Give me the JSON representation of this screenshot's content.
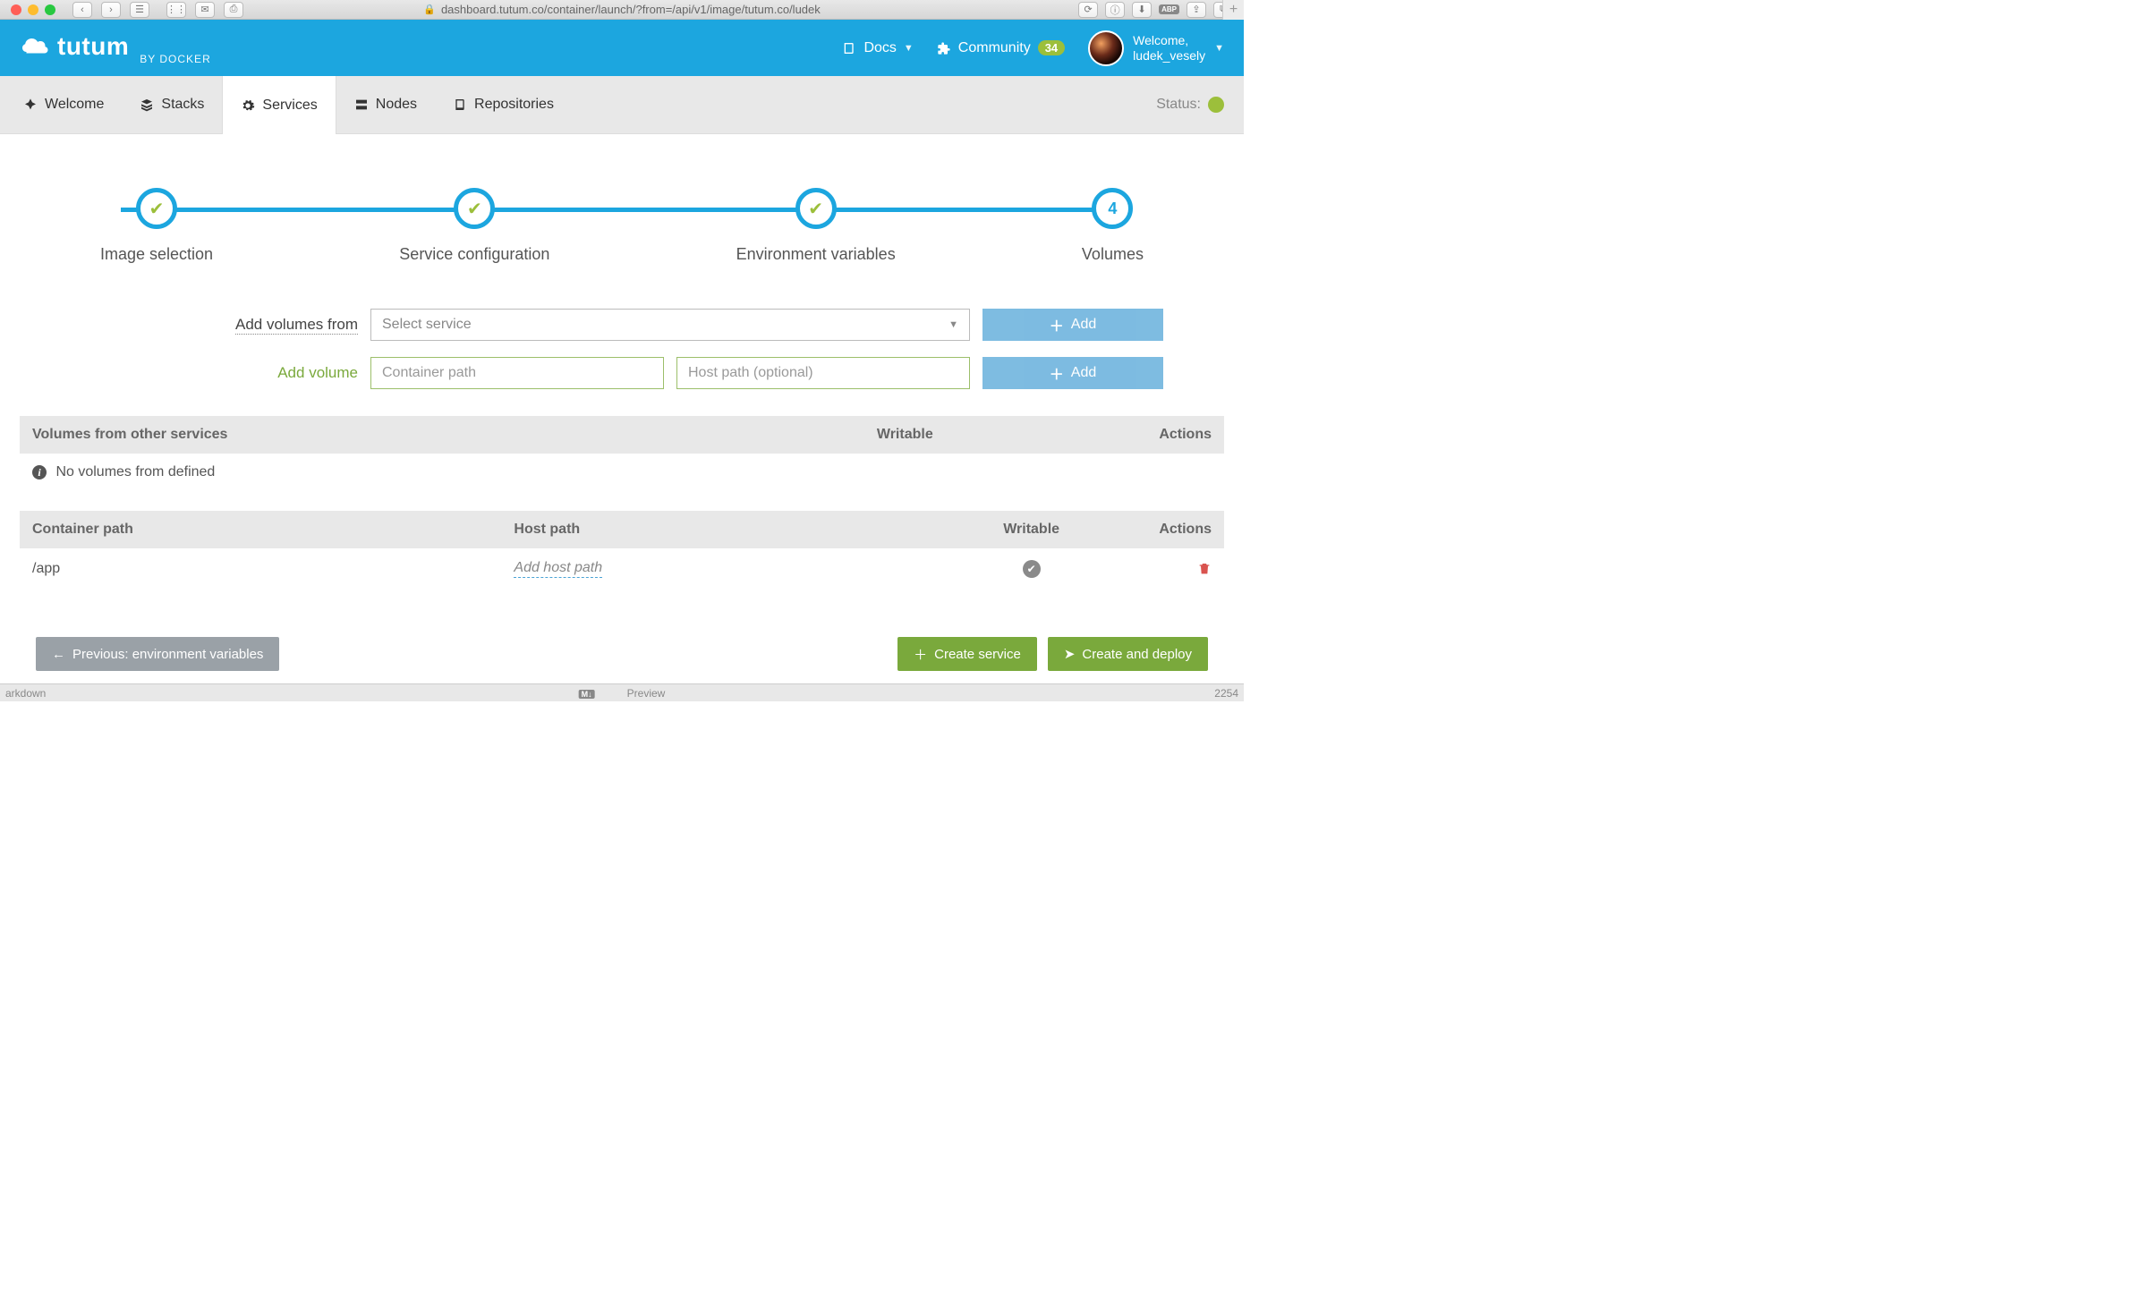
{
  "browser": {
    "url": "dashboard.tutum.co/container/launch/?from=/api/v1/image/tutum.co/ludek"
  },
  "brand": {
    "name": "tutum",
    "byline": "BY DOCKER"
  },
  "topnav": {
    "docs": "Docs",
    "community": "Community",
    "community_count": "34",
    "welcome": "Welcome,",
    "username": "ludek_vesely"
  },
  "tabs": {
    "welcome": "Welcome",
    "stacks": "Stacks",
    "services": "Services",
    "nodes": "Nodes",
    "repositories": "Repositories",
    "status_label": "Status:"
  },
  "stepper": {
    "s1": "Image selection",
    "s2": "Service configuration",
    "s3": "Environment variables",
    "s4": "Volumes",
    "s4_num": "4"
  },
  "form": {
    "add_volumes_from_label": "Add volumes from",
    "select_service_placeholder": "Select service",
    "add_button": "Add",
    "add_volume_label": "Add volume",
    "container_path_placeholder": "Container path",
    "host_path_placeholder": "Host path (optional)"
  },
  "table1": {
    "col1": "Volumes from other services",
    "col2": "Writable",
    "col3": "Actions",
    "empty": "No volumes from defined"
  },
  "table2": {
    "col1": "Container path",
    "col2": "Host path",
    "col3": "Writable",
    "col4": "Actions",
    "rows": [
      {
        "container": "/app",
        "host": "Add host path"
      }
    ]
  },
  "footer": {
    "prev": "Previous: environment variables",
    "create_service": "Create service",
    "create_deploy": "Create and deploy"
  },
  "statusbar": {
    "left": "arkdown",
    "preview": "Preview",
    "right": "2254"
  }
}
